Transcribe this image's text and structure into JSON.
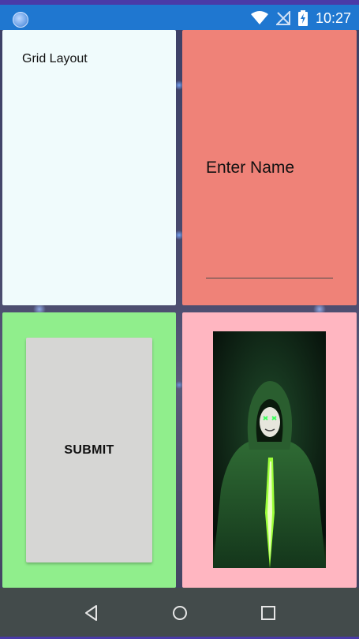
{
  "status_bar": {
    "time": "10:27",
    "icons": [
      "app-notification-icon",
      "wifi-icon",
      "no-signal-icon",
      "battery-charging-icon"
    ]
  },
  "grid": {
    "title": "Grid Layout",
    "name_label": "Enter Name",
    "name_input_value": "",
    "submit_label": "SUBMIT",
    "image_subject": "hooded-masked-figure-image"
  },
  "colors": {
    "status_bar": "#1f77d0",
    "cell_top_left": "#f0fbfc",
    "cell_top_right": "#ef8278",
    "cell_bottom_left": "#90ee8c",
    "cell_bottom_right": "#ffb6c1",
    "submit_button": "#d6d6d4",
    "nav_bar": "#434b4b"
  },
  "nav_bar": {
    "buttons": [
      "back-icon",
      "home-icon",
      "recents-icon"
    ]
  }
}
